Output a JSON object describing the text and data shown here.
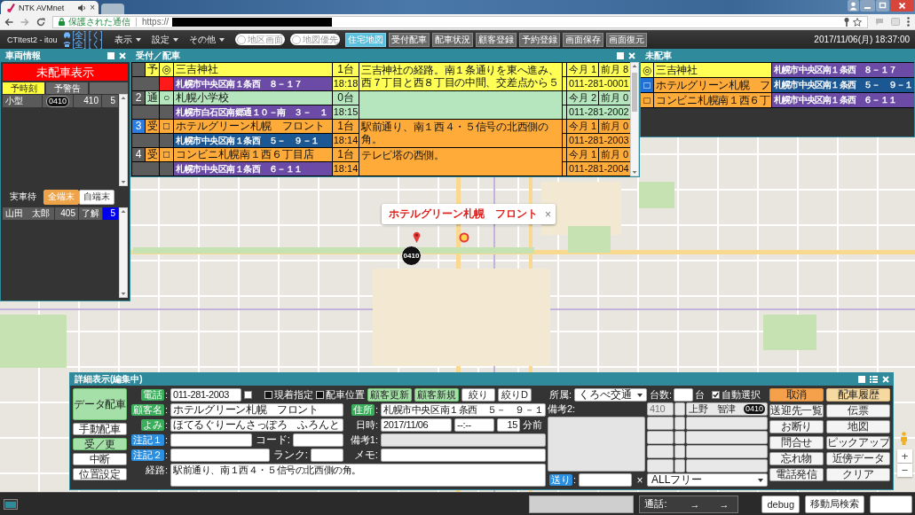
{
  "browser": {
    "tab_title": "NTK AVMnet",
    "tab_close": "×",
    "secure_label": "保護された通信",
    "url": "https://"
  },
  "toolbar": {
    "user": "CTItest2 - itou",
    "links": [
      {
        "kind": "car",
        "text": "[全] [く]"
      },
      {
        "kind": "phone",
        "text": "[全] [く]"
      }
    ],
    "menus": [
      "表示",
      "設定",
      "その他"
    ],
    "toggles": [
      {
        "label": "地区画面",
        "on": false
      },
      {
        "label": "地図優先",
        "on": false
      }
    ],
    "buttons": [
      {
        "label": "住宅地図",
        "selected": true
      },
      {
        "label": "受付配車",
        "selected": false
      },
      {
        "label": "配車状況",
        "selected": false
      },
      {
        "label": "顧客登録",
        "selected": false
      },
      {
        "label": "予約登録",
        "selected": false
      },
      {
        "label": "画面保存",
        "selected": false
      },
      {
        "label": "画面復元",
        "selected": false
      }
    ],
    "clock": "2017/11/06(月) 18:37:00"
  },
  "vehicle_panel": {
    "title": "車両情報",
    "banner": "未配車表示",
    "tabs": [
      {
        "label": "予時刻",
        "selected": true
      },
      {
        "label": "予警告",
        "selected": false
      }
    ],
    "vehicles": [
      {
        "type": "小型",
        "number": "0410",
        "code": "410",
        "count": "5"
      }
    ],
    "waiting_label": "実車待",
    "filters": [
      {
        "label": "全端末",
        "selected": true
      },
      {
        "label": "自端末",
        "selected": false
      }
    ],
    "drivers": [
      {
        "name": "山田　太郎",
        "code": "405",
        "status": "了解",
        "count": "5"
      }
    ]
  },
  "dispatch_panel": {
    "title": "受付／配車",
    "rows": [
      {
        "status": "予",
        "mark": "◎",
        "name": "三吉神社",
        "cars": "1台",
        "note": "三吉神社の経路。南１条通りを東へ進み、西７丁目と西８丁目の中間、交差点から５",
        "this_month_label": "今月",
        "this_month": "1",
        "last_month_label": "前月",
        "last_month": "8",
        "address": "札幌市中央区南１条西　８－１７",
        "time": "18:18",
        "phone": "011-281-0001",
        "color": "#ffff55",
        "alert": true,
        "selected": false
      },
      {
        "number": "2",
        "status": "通",
        "mark": "○",
        "name": "札幌小学校",
        "cars": "0台",
        "this_month_label": "今月",
        "this_month": "2",
        "last_month_label": "前月",
        "last_month": "0",
        "address": "札幌市白石区南郷通１０－南　３－　１",
        "time": "18:15",
        "phone": "011-281-2002",
        "color": "#b5e6bd",
        "alert": false,
        "selected": false
      },
      {
        "number": "3",
        "status": "受",
        "mark": "□",
        "name": "ホテルグリーン札幌　フロント",
        "cars": "1台",
        "note": "駅前通り、南１西４・５信号の北西側の角。",
        "this_month_label": "今月",
        "this_month": "1",
        "last_month_label": "前月",
        "last_month": "0",
        "address": "札幌市中央区南１条西　５－　９－１",
        "time": "18:14",
        "phone": "011-281-2003",
        "color": "#ffab3a",
        "alert": false,
        "selected": true
      },
      {
        "number": "4",
        "status": "受",
        "mark": "□",
        "name": "コンビニ札幌南１西６丁目店",
        "cars": "1台",
        "note": "テレビ塔の西側。",
        "this_month_label": "今月",
        "this_month": "1",
        "last_month_label": "前月",
        "last_month": "0",
        "address": "札幌市中央区南１条西　６－１１",
        "time": "18:14",
        "phone": "011-281-2004",
        "color": "#ffab3a",
        "alert": false,
        "selected": false
      }
    ]
  },
  "unassigned_panel": {
    "title": "未配車",
    "rows": [
      {
        "mark": "◎",
        "name": "三吉神社",
        "address": "札幌市中央区南１条西　８－１７",
        "color": "#ffff55",
        "selected": false
      },
      {
        "mark": "□",
        "name": "ホテルグリーン札幌　フ",
        "address": "札幌市中央区南１条西　５－　９－１",
        "color": "#ffab3a",
        "selected": true
      },
      {
        "mark": "□",
        "name": "コンビニ札幌南１西６丁",
        "address": "札幌市中央区南１条西　６－１１",
        "color": "#ffab3a",
        "selected": false
      }
    ]
  },
  "map": {
    "popup": {
      "title": "ホテルグリーン札幌　フロント",
      "close": "×"
    },
    "vehicle_marker": "0410",
    "zoom_in": "+",
    "zoom_out": "−"
  },
  "detail_panel": {
    "title": "詳細表示(編集中)",
    "side_buttons": [
      {
        "label": "データ配車",
        "highlighted": true
      },
      {
        "label": "手動配車",
        "highlighted": false
      },
      {
        "label": "受／更",
        "highlighted": true
      },
      {
        "label": "中断",
        "highlighted": false
      },
      {
        "label": "位置設定",
        "highlighted": false
      }
    ],
    "phone": {
      "label": "電話",
      "kind": "primary",
      "suffix": ":",
      "value": "011-281-2003",
      "checked": false
    },
    "options": [
      {
        "label": "現着指定",
        "checked": false
      },
      {
        "label": "配車位置",
        "checked": false
      }
    ],
    "customer_buttons": [
      {
        "label": "顧客更新",
        "highlighted": true
      },
      {
        "label": "顧客新規",
        "highlighted": true
      },
      {
        "label": "絞り",
        "highlighted": false
      },
      {
        "label": "絞りD",
        "highlighted": false
      }
    ],
    "company": {
      "label": "所属:",
      "value": "くろべ交通"
    },
    "customer_name": {
      "label": "顧客名",
      "kind": "primary",
      "suffix": ":",
      "value": "ホテルグリーン札幌　フロント"
    },
    "address": {
      "label": "住所",
      "kind": "primary",
      "suffix": ":",
      "value": "札幌市中央区南１条西　５－　９－１"
    },
    "reading": {
      "label": "よみ",
      "kind": "primary",
      "suffix": ":",
      "value": "ほてるぐりーんさっぽろ　ふろんと"
    },
    "datetime": {
      "label": "日時:",
      "date": "2017/11/06",
      "time": "--:--",
      "minutes": "15",
      "unit": "分前"
    },
    "note1": {
      "label": "注記１",
      "kind": "secondary",
      "suffix": ":"
    },
    "code": {
      "label": "コード:"
    },
    "remark1": {
      "label": "備考1:"
    },
    "note2": {
      "label": "注記２",
      "kind": "secondary",
      "suffix": ":"
    },
    "rank": {
      "label": "ランク:"
    },
    "memo": {
      "label": "メモ:"
    },
    "route": {
      "label": "経路:",
      "value": "駅前通り、南１西４・５信号の北西側の角。"
    },
    "remark2": {
      "label": "備考2:"
    },
    "send": {
      "label": "送り",
      "kind": "secondary",
      "suffix": ":",
      "clear": "×"
    },
    "car_count": {
      "label": "台数:",
      "unit": "台"
    },
    "auto_select": {
      "label": "自動選択",
      "checked": true
    },
    "cars": [
      {
        "code": "410",
        "driver": "上野　智津",
        "number": "0410"
      }
    ],
    "car_filter": "ALLフリー",
    "actions": [
      {
        "label": "取消",
        "kind": "cancel"
      },
      {
        "label": "配車履歴",
        "kind": "history"
      },
      {
        "label": "送迎先一覧",
        "kind": "plain"
      },
      {
        "label": "伝票",
        "kind": "plain"
      },
      {
        "label": "お断り",
        "kind": "plain"
      },
      {
        "label": "地図",
        "kind": "plain"
      },
      {
        "label": "問合せ",
        "kind": "plain"
      },
      {
        "label": "ピックアップ",
        "kind": "plain"
      },
      {
        "label": "忘れ物",
        "kind": "plain"
      },
      {
        "label": "近傍データ",
        "kind": "plain"
      },
      {
        "label": "電話発信",
        "kind": "plain"
      },
      {
        "label": "クリア",
        "kind": "plain"
      }
    ]
  },
  "bottom_bar": {
    "call_label": "通話:",
    "arrows": [
      "→",
      "→"
    ],
    "buttons": [
      "debug",
      "移動局検索"
    ]
  }
}
